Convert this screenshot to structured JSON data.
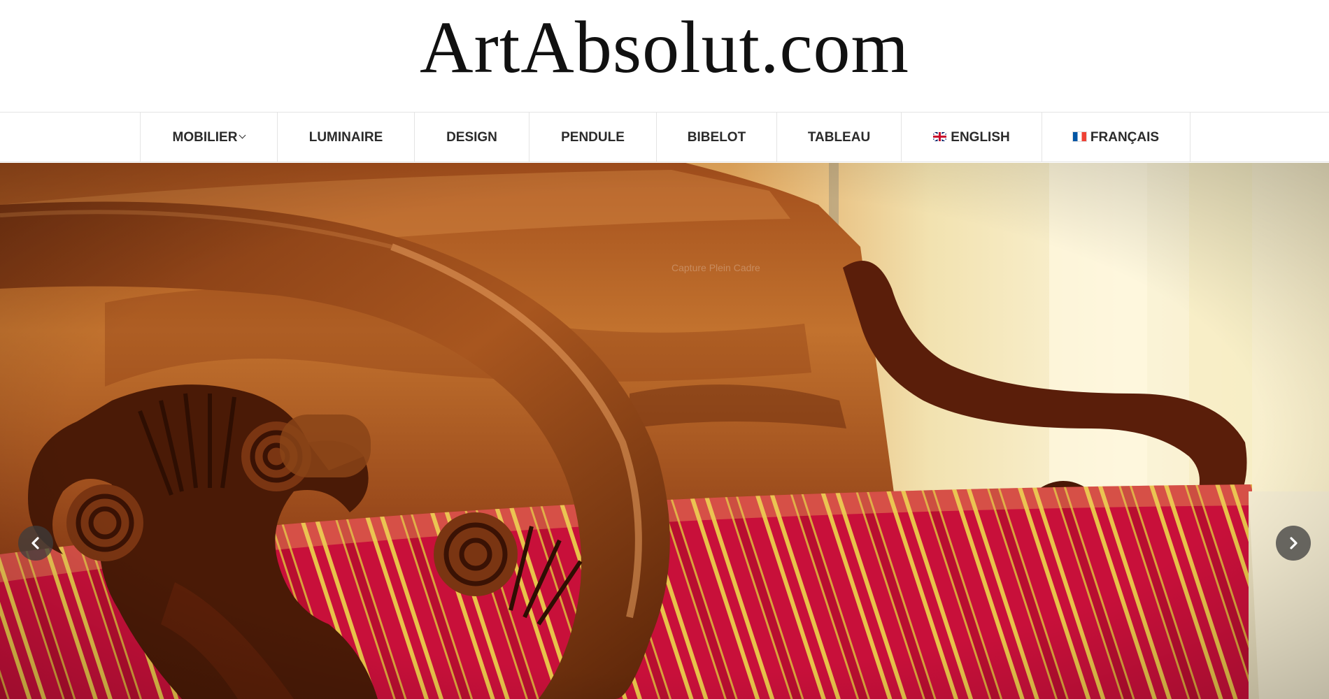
{
  "site": {
    "logo_text": "ArtAbsolut.com"
  },
  "nav": {
    "items": [
      {
        "label": "MOBILIER",
        "has_dropdown": true
      },
      {
        "label": "LUMINAIRE"
      },
      {
        "label": "DESIGN"
      },
      {
        "label": "PENDULE"
      },
      {
        "label": "BIBELOT"
      },
      {
        "label": "TABLEAU"
      },
      {
        "label": "ENGLISH",
        "icon": "uk-flag-icon"
      },
      {
        "label": "FRANÇAIS",
        "icon": "france-flag-icon"
      }
    ]
  },
  "hero": {
    "watermark": "Capture Plein Cadre",
    "prev_icon": "chevron-left-icon",
    "next_icon": "chevron-right-icon"
  },
  "colors": {
    "nav_text": "#2b2b2b",
    "nav_border": "#e4e4e4",
    "mahogany": "#7a3512",
    "upholstery_red": "#c8103a",
    "upholstery_gold": "#e8c24a"
  }
}
